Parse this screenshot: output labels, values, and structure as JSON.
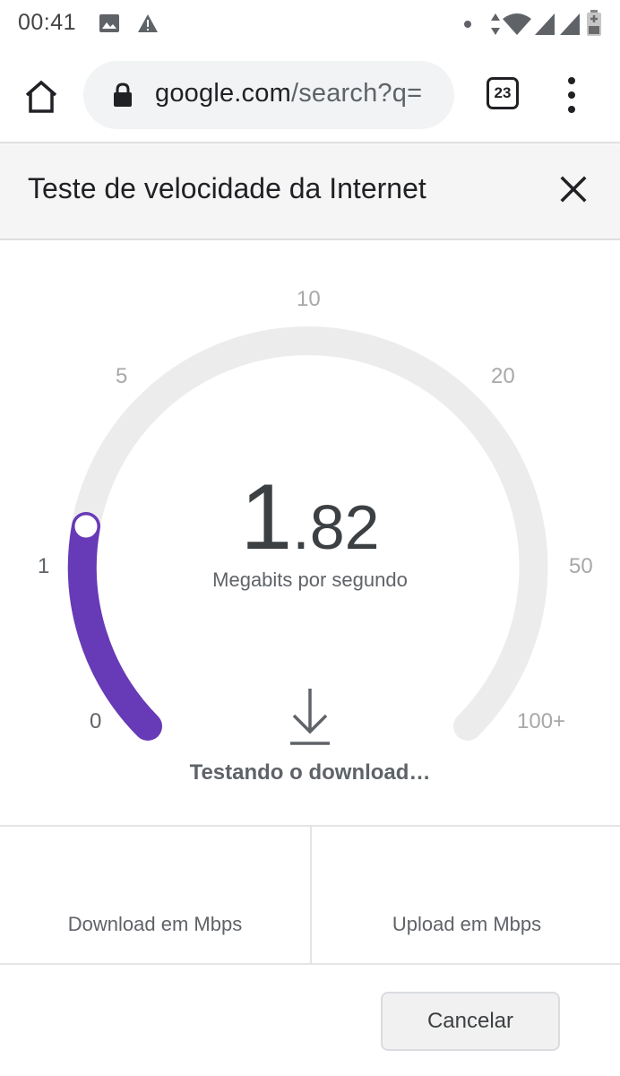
{
  "status_bar": {
    "time": "00:41",
    "left_icons": [
      "image-icon",
      "warning-icon"
    ],
    "right_icons": [
      "notification-dot-icon",
      "data-arrows-icon",
      "wifi-icon",
      "signal-icon",
      "signal-icon",
      "battery-icon"
    ]
  },
  "browser": {
    "url_host": "google.com",
    "url_path": "/search?q=",
    "tab_count": "23",
    "icons": [
      "home-icon",
      "lock-icon",
      "more-vert-icon"
    ]
  },
  "dialog": {
    "title": "Teste de velocidade da Internet",
    "close_icon": "close-icon"
  },
  "gauge": {
    "ticks": [
      "0",
      "1",
      "5",
      "10",
      "20",
      "50",
      "100+"
    ],
    "speed_int": "1",
    "speed_dec": ".82",
    "unit": "Megabits por segundo",
    "status": "Testando o download…",
    "current_value": 1.82,
    "progress_color": "#673ab7",
    "track_color": "#ececec"
  },
  "results": {
    "download_label": "Download em Mbps",
    "upload_label": "Upload em Mbps"
  },
  "actions": {
    "cancel_label": "Cancelar"
  }
}
